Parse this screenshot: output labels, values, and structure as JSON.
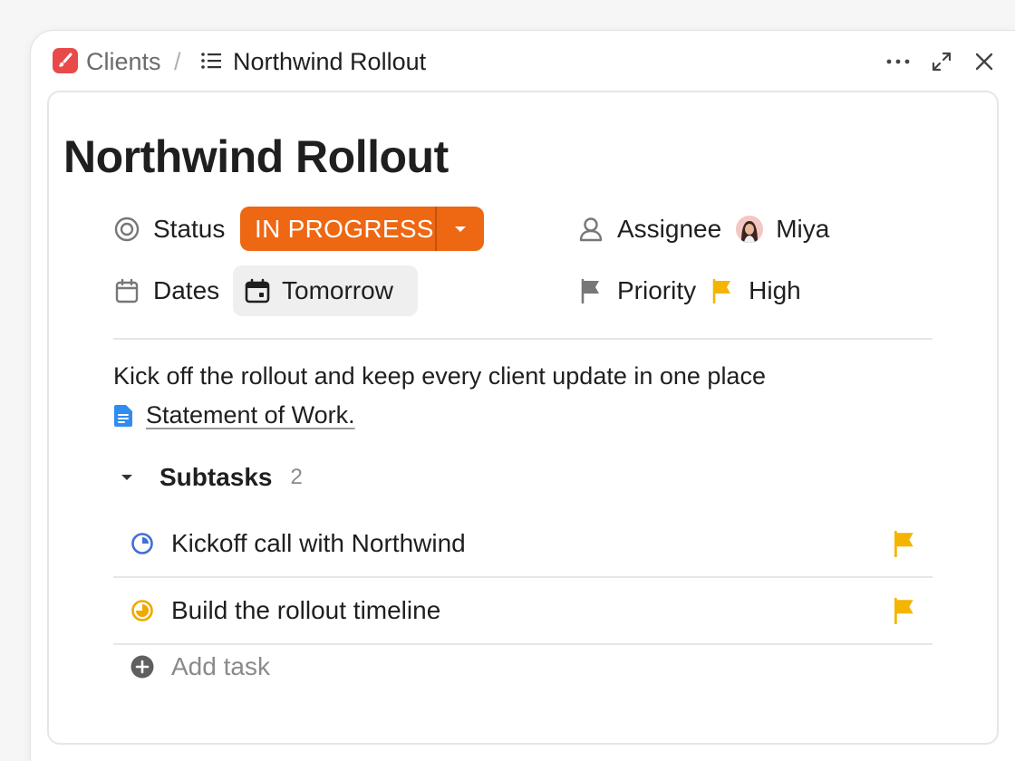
{
  "breadcrumb": {
    "root": "Clients",
    "separator": "/",
    "current": "Northwind Rollout"
  },
  "task": {
    "title": "Northwind Rollout",
    "status": {
      "label": "Status",
      "value": "IN PROGRESS",
      "color": "#ee6712"
    },
    "assignee": {
      "label": "Assignee",
      "value": "Miya"
    },
    "dates": {
      "label": "Dates",
      "value": "Tomorrow"
    },
    "priority": {
      "label": "Priority",
      "value": "High",
      "color": "#f5b400"
    },
    "description": "Kick off the rollout and keep every client update in one place",
    "attachment": "Statement of Work."
  },
  "subtasks": {
    "label": "Subtasks",
    "count": "2",
    "items": [
      {
        "label": "Kickoff call with Northwind",
        "status_icon": "progress-quarter-icon",
        "status_color": "#3f6fd8",
        "priority_color": "#f5b400"
      },
      {
        "label": "Build the rollout timeline",
        "status_icon": "progress-three-quarter-icon",
        "status_color": "#f0a800",
        "priority_color": "#f5b400"
      }
    ],
    "add_label": "Add task"
  }
}
